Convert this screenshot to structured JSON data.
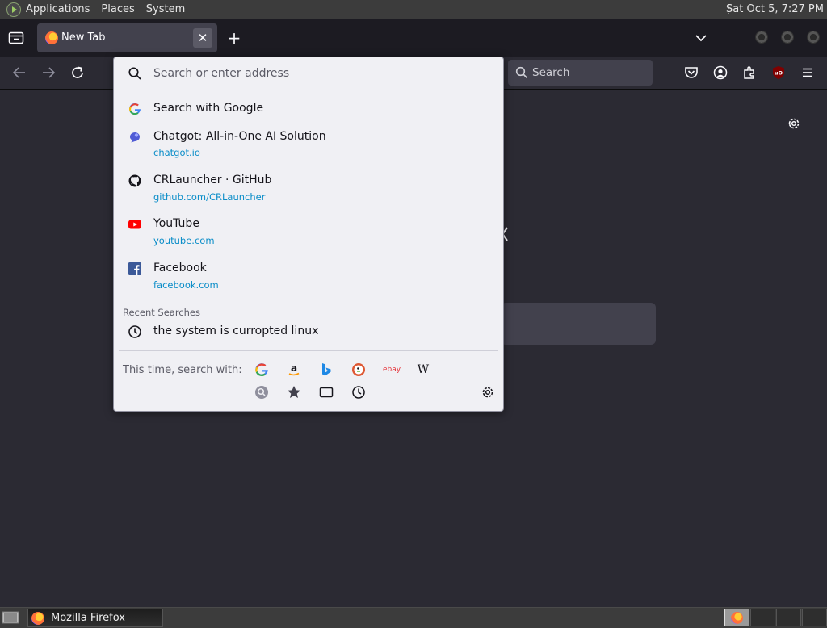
{
  "panel": {
    "menus": [
      "Applications",
      "Places",
      "System"
    ],
    "clock": "Sat Oct  5,  7:27 PM"
  },
  "tabs": [
    {
      "title": "New Tab",
      "close": "✕"
    }
  ],
  "new_tab_symbol": "+",
  "toolbar": {
    "search_label": "Search"
  },
  "urlbar": {
    "placeholder": "Search or enter address",
    "results": [
      {
        "title": "Search with Google",
        "url": "",
        "icon": "google-icon"
      },
      {
        "title": "Chatgot: All-in-One AI Solution",
        "url": "chatgot.io",
        "icon": "chatgot-icon"
      },
      {
        "title": "CRLauncher · GitHub",
        "url": "github.com/CRLauncher",
        "icon": "github-icon"
      },
      {
        "title": "YouTube",
        "url": "youtube.com",
        "icon": "youtube-icon"
      },
      {
        "title": "Facebook",
        "url": "facebook.com",
        "icon": "facebook-icon"
      }
    ],
    "recent_label": "Recent Searches",
    "recent": [
      {
        "title": "the system is curropted linux",
        "icon": "history-icon"
      }
    ],
    "one_off_label": "This time, search with:",
    "engines": [
      "google",
      "amazon",
      "bing",
      "duckduckgo",
      "ebay",
      "wikipedia"
    ],
    "engine_ebay_text": "ebay",
    "engine_wiki_text": "W",
    "modes": [
      "search-mode",
      "bookmarks",
      "tabs",
      "history"
    ]
  },
  "taskbar": {
    "window_label": "Mozilla Firefox"
  },
  "colors": {
    "accent_link": "#0a8dc8",
    "youtube": "#ff0000",
    "facebook": "#3b5998"
  }
}
